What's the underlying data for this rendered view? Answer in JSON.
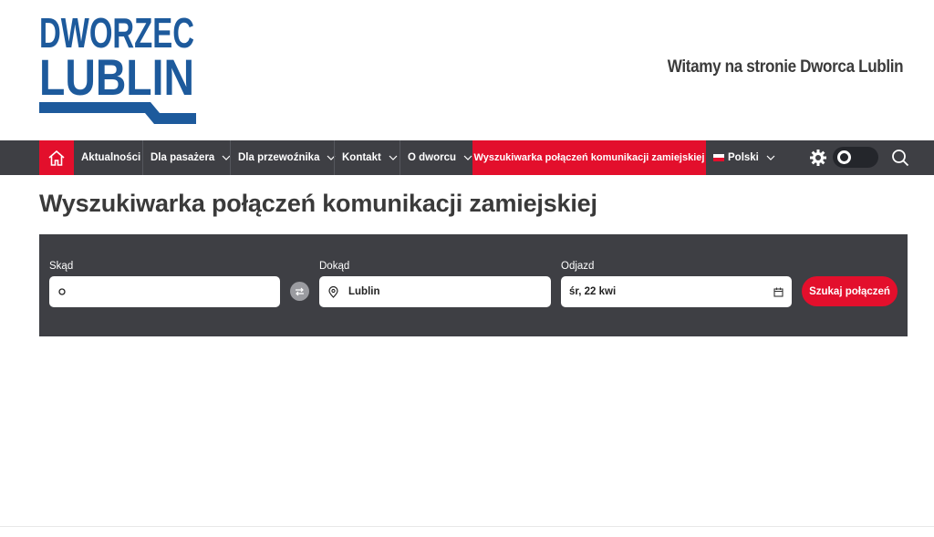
{
  "header": {
    "logo_line1": "DWORZEC",
    "logo_line2": "LUBLIN",
    "welcome": "Witamy na stronie Dworca Lublin"
  },
  "nav": {
    "items": [
      {
        "label": "Aktualności",
        "dropdown": false
      },
      {
        "label": "Dla pasażera",
        "dropdown": true
      },
      {
        "label": "Dla przewoźnika",
        "dropdown": true
      },
      {
        "label": "Kontakt",
        "dropdown": true
      },
      {
        "label": "O dworcu",
        "dropdown": true
      },
      {
        "label": "Wyszukiwarka połączeń komunikacji zamiejskiej",
        "dropdown": false,
        "active": true
      }
    ],
    "language": "Polski"
  },
  "page": {
    "title": "Wyszukiwarka połączeń komunikacji zamiejskiej"
  },
  "search": {
    "from_label": "Skąd",
    "from_value": "",
    "to_label": "Dokąd",
    "to_value": "Lublin",
    "date_label": "Odjazd",
    "date_value": "śr, 22 kwi",
    "button": "Szukaj połączeń"
  },
  "colors": {
    "brand_blue": "#1d5a9c",
    "accent_red": "#e30f2c",
    "nav_dark": "#3e3f44"
  }
}
